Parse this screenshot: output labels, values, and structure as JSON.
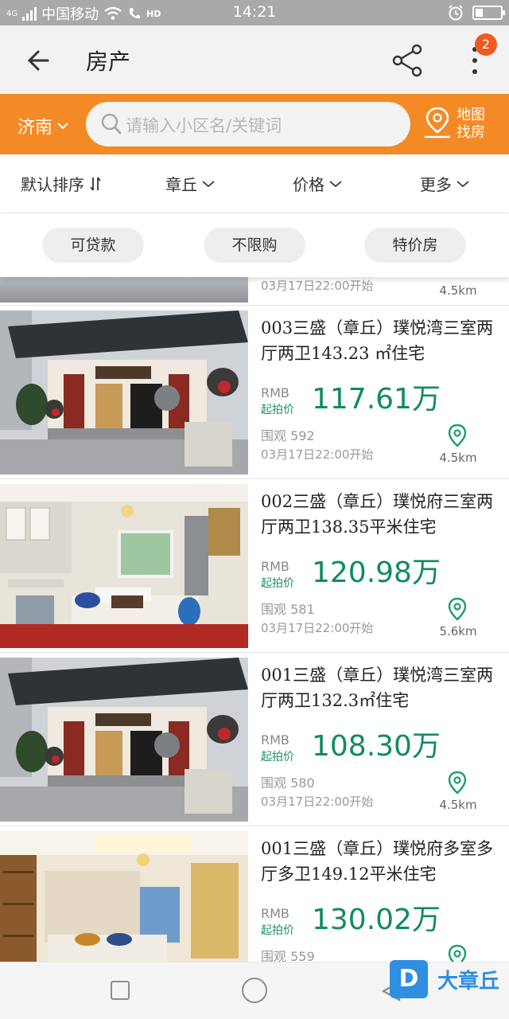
{
  "status": {
    "net_tag": "4G",
    "carrier": "中国移动",
    "hd_tag": "HD",
    "time": "14:21",
    "battery_level": 0.3
  },
  "header": {
    "title": "房产",
    "notification_count": "2"
  },
  "search": {
    "city": "济南",
    "placeholder": "请输入小区名/关键词",
    "map_label_line1": "地图",
    "map_label_line2": "找房"
  },
  "sort_bar": {
    "default_sort": "默认排序",
    "district": "章丘",
    "price": "价格",
    "more": "更多"
  },
  "tags": [
    "可贷款",
    "不限购",
    "特价房"
  ],
  "partial_listing": {
    "start_time": "03月17日22:00开始",
    "distance": "4.5km"
  },
  "listings": [
    {
      "name": "003三盛（章丘）璞悦湾三室两厅两卫143.23 ㎡住宅",
      "currency": "RMB",
      "price_label": "起拍价",
      "price": "117.61万",
      "views": "围观 592",
      "start_time": "03月17日22:00开始",
      "distance": "4.5km"
    },
    {
      "name": "002三盛（章丘）璞悦府三室两厅两卫138.35平米住宅",
      "currency": "RMB",
      "price_label": "起拍价",
      "price": "120.98万",
      "views": "围观 581",
      "start_time": "03月17日22:00开始",
      "distance": "5.6km"
    },
    {
      "name": "001三盛（章丘）璞悦湾三室两厅两卫132.3㎡住宅",
      "currency": "RMB",
      "price_label": "起拍价",
      "price": "108.30万",
      "views": "围观 580",
      "start_time": "03月17日22:00开始",
      "distance": "4.5km"
    },
    {
      "name": "001三盛（章丘）璞悦府多室多厅多卫149.12平米住宅",
      "currency": "RMB",
      "price_label": "起拍价",
      "price": "130.02万",
      "views": "围观 559",
      "start_time": "",
      "distance": ""
    }
  ],
  "watermark": {
    "logo_letter": "D",
    "text": "大章丘"
  },
  "colors": {
    "accent_orange": "#f48a25",
    "price_green": "#128a62",
    "badge_red": "#ef5a1f"
  }
}
